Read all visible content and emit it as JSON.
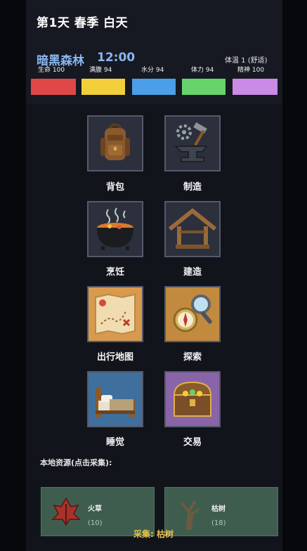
{
  "header": {
    "day": "第1天 春季 白天",
    "location": "暗黑森林",
    "time": "12:00",
    "temperature": "体温 1 (舒适)"
  },
  "stats": [
    {
      "label": "生命 100",
      "value": 100,
      "color": "#e04848"
    },
    {
      "label": "满腹 94",
      "value": 94,
      "color": "#f2cf3a"
    },
    {
      "label": "水分 94",
      "value": 94,
      "color": "#4a9fe8"
    },
    {
      "label": "体力 94",
      "value": 94,
      "color": "#66d46a"
    },
    {
      "label": "精神 100",
      "value": 100,
      "color": "#c98be6"
    }
  ],
  "actions": [
    {
      "label": "背包",
      "icon": "backpack-icon"
    },
    {
      "label": "制造",
      "icon": "anvil-hammer-icon"
    },
    {
      "label": "烹饪",
      "icon": "cooking-pot-icon"
    },
    {
      "label": "建造",
      "icon": "house-frame-icon"
    },
    {
      "label": "出行地图",
      "icon": "treasure-map-icon"
    },
    {
      "label": "探索",
      "icon": "compass-magnifier-icon"
    },
    {
      "label": "睡觉",
      "icon": "bed-icon"
    },
    {
      "label": "交易",
      "icon": "treasure-chest-icon"
    }
  ],
  "resources": {
    "title": "本地资源(点击采集):",
    "items": [
      {
        "name": "火草",
        "count": "(10)",
        "icon": "fire-grass-icon"
      },
      {
        "name": "枯树",
        "count": "(18)",
        "icon": "dead-tree-icon"
      }
    ]
  },
  "gather_status": "采集: 枯树",
  "colors": {
    "tile_default": "#2b303c",
    "tile_map": "#d89a4e",
    "tile_explore": "#c28a3f",
    "tile_sleep": "#3f6f9c",
    "tile_trade": "#8a64a8"
  }
}
